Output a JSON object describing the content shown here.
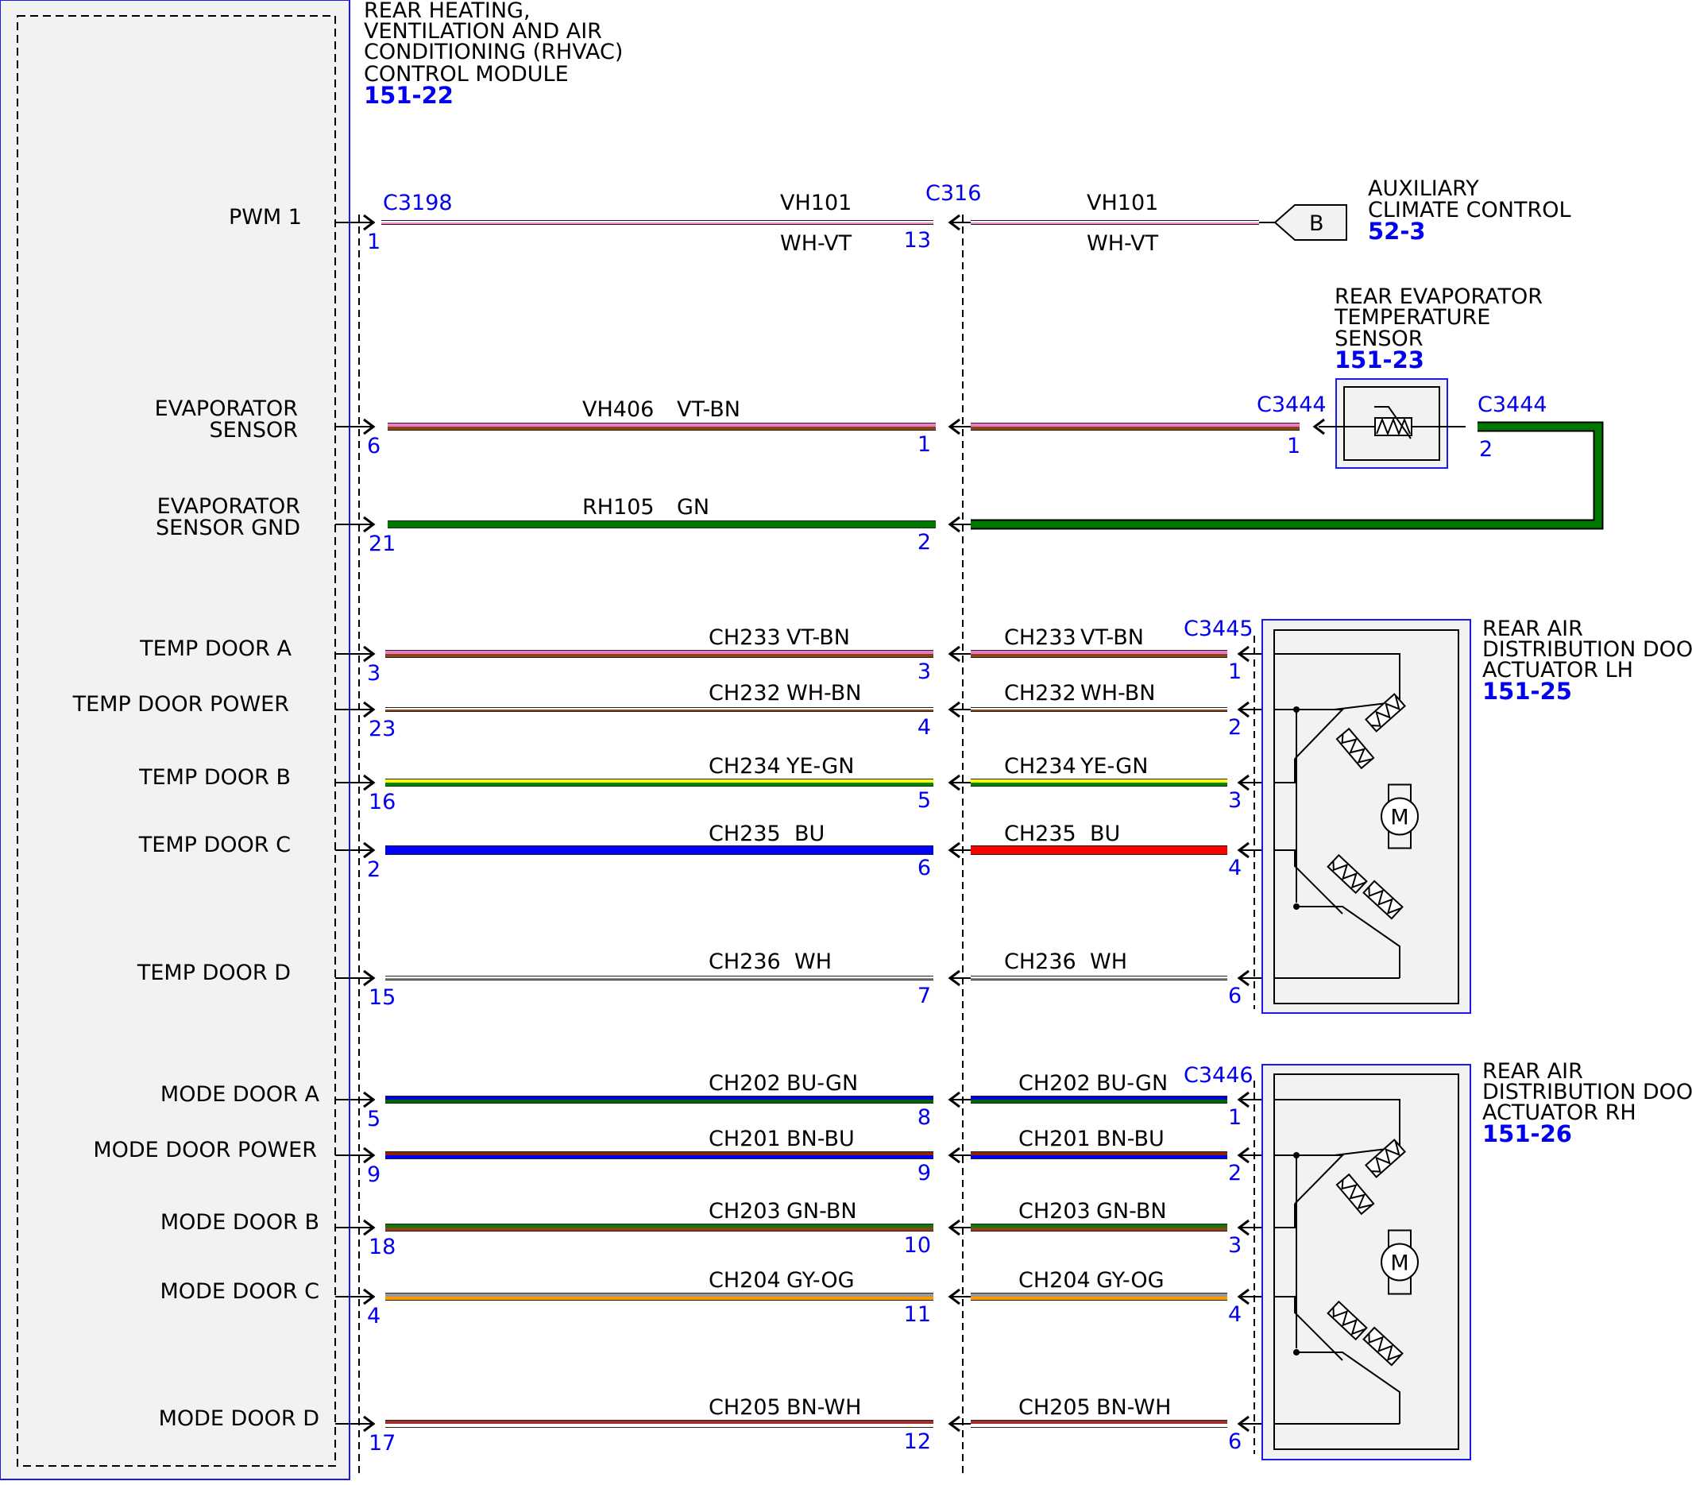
{
  "module": {
    "title_lines": [
      "REAR HEATING,",
      "VENTILATION AND AIR",
      "CONDITIONING (RHVAC)",
      "CONTROL MODULE"
    ],
    "ref": "151-22",
    "connector": "C3198"
  },
  "inline_connector": "C316",
  "pins": [
    {
      "label": [
        "PWM 1"
      ],
      "mod_pin": "1",
      "mid_pin": "13",
      "circuit": "VH101",
      "color_code": "WH-VT",
      "right_circuit": "VH101",
      "right_color_code": "WH-VT",
      "dest_pin": ""
    },
    {
      "label": [
        "EVAPORATOR",
        "SENSOR"
      ],
      "mod_pin": "6",
      "mid_pin": "1",
      "circuit": "VH406",
      "color_code": "VT-BN",
      "right_circuit": "",
      "right_color_code": "",
      "dest_pin": "1"
    },
    {
      "label": [
        "EVAPORATOR",
        "SENSOR GND"
      ],
      "mod_pin": "21",
      "mid_pin": "2",
      "circuit": "RH105",
      "color_code": "GN",
      "right_circuit": "",
      "right_color_code": "",
      "dest_pin": ""
    },
    {
      "label": [
        "TEMP DOOR A"
      ],
      "mod_pin": "3",
      "mid_pin": "3",
      "circuit": "CH233",
      "color_code": "VT-BN",
      "right_circuit": "CH233",
      "right_color_code": "VT-BN",
      "dest_pin": "1"
    },
    {
      "label": [
        "TEMP DOOR POWER"
      ],
      "mod_pin": "23",
      "mid_pin": "4",
      "circuit": "CH232",
      "color_code": "WH-BN",
      "right_circuit": "CH232",
      "right_color_code": "WH-BN",
      "dest_pin": "2"
    },
    {
      "label": [
        "TEMP DOOR B"
      ],
      "mod_pin": "16",
      "mid_pin": "5",
      "circuit": "CH234",
      "color_code": "YE-GN",
      "right_circuit": "CH234",
      "right_color_code": "YE-GN",
      "dest_pin": "3"
    },
    {
      "label": [
        "TEMP DOOR C"
      ],
      "mod_pin": "2",
      "mid_pin": "6",
      "circuit": "CH235",
      "color_code": "BU",
      "right_circuit": "CH235",
      "right_color_code": "BU",
      "dest_pin": "4"
    },
    {
      "label": [
        "TEMP DOOR D"
      ],
      "mod_pin": "15",
      "mid_pin": "7",
      "circuit": "CH236",
      "color_code": "WH",
      "right_circuit": "CH236",
      "right_color_code": "WH",
      "dest_pin": "6"
    },
    {
      "label": [
        "MODE DOOR A"
      ],
      "mod_pin": "5",
      "mid_pin": "8",
      "circuit": "CH202",
      "color_code": "BU-GN",
      "right_circuit": "CH202",
      "right_color_code": "BU-GN",
      "dest_pin": "1"
    },
    {
      "label": [
        "MODE DOOR POWER"
      ],
      "mod_pin": "9",
      "mid_pin": "9",
      "circuit": "CH201",
      "color_code": "BN-BU",
      "right_circuit": "CH201",
      "right_color_code": "BN-BU",
      "dest_pin": "2"
    },
    {
      "label": [
        "MODE DOOR B"
      ],
      "mod_pin": "18",
      "mid_pin": "10",
      "circuit": "CH203",
      "color_code": "GN-BN",
      "right_circuit": "CH203",
      "right_color_code": "GN-BN",
      "dest_pin": "3"
    },
    {
      "label": [
        "MODE DOOR C"
      ],
      "mod_pin": "4",
      "mid_pin": "11",
      "circuit": "CH204",
      "color_code": "GY-OG",
      "right_circuit": "CH204",
      "right_color_code": "GY-OG",
      "dest_pin": "4"
    },
    {
      "label": [
        "MODE DOOR D"
      ],
      "mod_pin": "17",
      "mid_pin": "12",
      "circuit": "CH205",
      "color_code": "BN-WH",
      "right_circuit": "CH205",
      "right_color_code": "BN-WH",
      "dest_pin": "6"
    }
  ],
  "auxiliary": {
    "title_lines": [
      "AUXILIARY",
      "CLIMATE CONTROL"
    ],
    "ref": "52-3",
    "tag": "B"
  },
  "evap_sensor": {
    "title_lines": [
      "REAR EVAPORATOR",
      "TEMPERATURE",
      "SENSOR"
    ],
    "ref": "151-23",
    "connector_in": "C3444",
    "connector_out": "C3444",
    "pin_out": "2"
  },
  "actuator_lh": {
    "title_lines": [
      "REAR AIR",
      "DISTRIBUTION DOOR",
      "ACTUATOR LH"
    ],
    "ref": "151-25",
    "connector": "C3445",
    "motor_label": "M"
  },
  "actuator_rh": {
    "title_lines": [
      "REAR AIR",
      "DISTRIBUTION DOOR",
      "ACTUATOR RH"
    ],
    "ref": "151-26",
    "connector": "C3446",
    "motor_label": "M"
  },
  "wire_colors": {
    "WH-VT": [
      "#ffffff",
      "#ee88cc"
    ],
    "VT-BN": [
      "#ee77cc",
      "#8b4513"
    ],
    "GN": [
      "#007700",
      "#007700"
    ],
    "WH-BN": [
      "#ffffff",
      "#8b4513"
    ],
    "YE-GN": [
      "#ffff00",
      "#008800"
    ],
    "BU": [
      "#0000ff",
      "#0000ff"
    ],
    "BU_right": [
      "#ff0000",
      "#ff0000"
    ],
    "WH": [
      "#ffffff",
      "#888888"
    ],
    "BU-GN": [
      "#0000dd",
      "#006600"
    ],
    "BN-BU": [
      "#8b2500",
      "#0000ff"
    ],
    "GN-BN": [
      "#117711",
      "#8b4513"
    ],
    "GY-OG": [
      "#999999",
      "#ff9900"
    ],
    "BN-WH": [
      "#a03030",
      "#ffffff"
    ]
  }
}
